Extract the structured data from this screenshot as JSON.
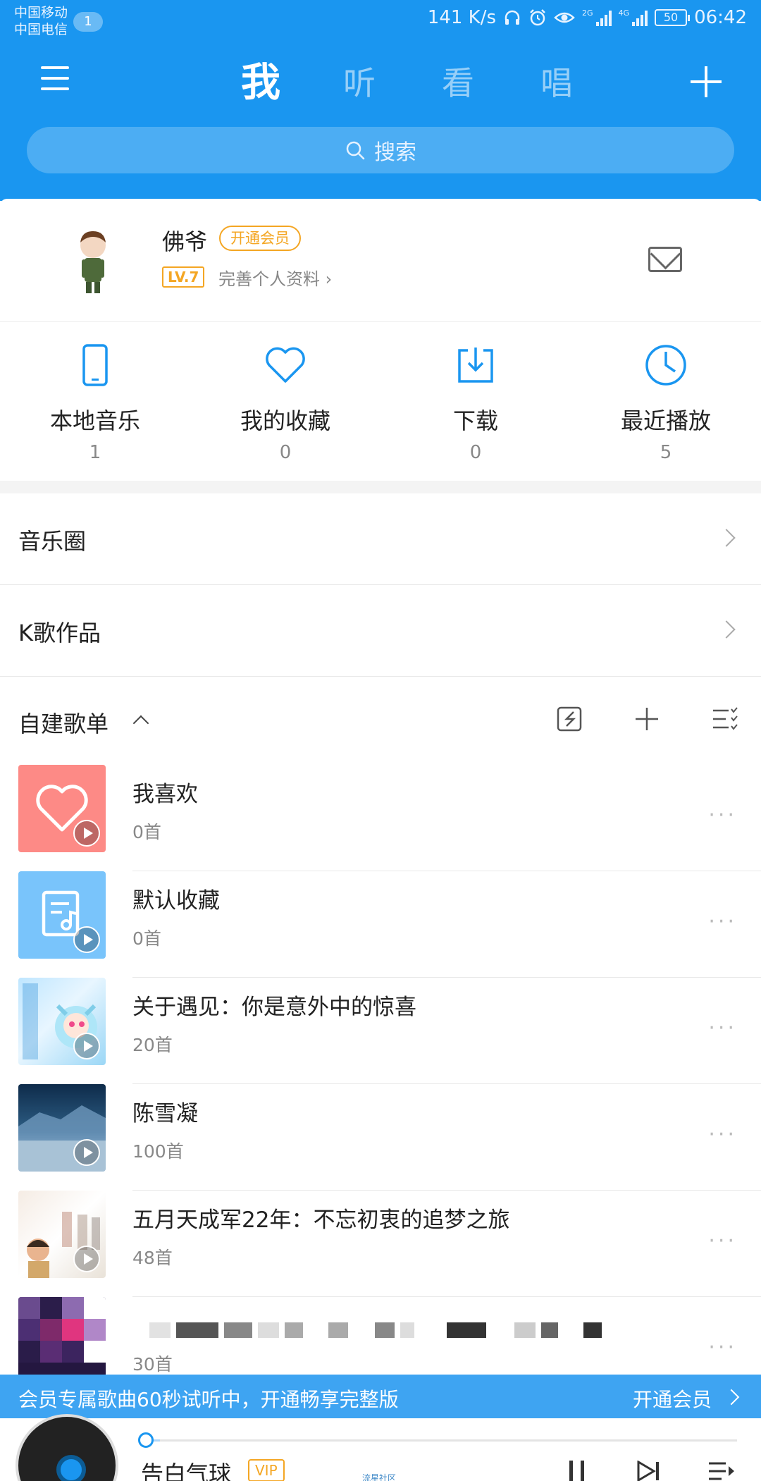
{
  "status_bar": {
    "carrier1": "中国移动",
    "carrier2": "中国电信",
    "notification_count": "1",
    "speed": "141 K/s",
    "net1": "2G",
    "net2": "4G",
    "battery": "50",
    "time": "06:42"
  },
  "nav": {
    "tabs": [
      {
        "label": "我",
        "active": true
      },
      {
        "label": "听",
        "active": false
      },
      {
        "label": "看",
        "active": false
      },
      {
        "label": "唱",
        "active": false
      }
    ],
    "search_placeholder": "搜索"
  },
  "profile": {
    "name": "佛爷",
    "vip_button": "开通会员",
    "level": "LV.7",
    "complete_profile": "完善个人资料"
  },
  "quick_access": [
    {
      "label": "本地音乐",
      "count": "1",
      "icon": "phone-icon"
    },
    {
      "label": "我的收藏",
      "count": "0",
      "icon": "heart-icon"
    },
    {
      "label": "下载",
      "count": "0",
      "icon": "download-icon"
    },
    {
      "label": "最近播放",
      "count": "5",
      "icon": "clock-icon"
    }
  ],
  "menu_rows": [
    {
      "label": "音乐圈"
    },
    {
      "label": "K歌作品"
    }
  ],
  "playlists_section": {
    "title": "自建歌单",
    "items": [
      {
        "name": "我喜欢",
        "count": "0首"
      },
      {
        "name": "默认收藏",
        "count": "0首"
      },
      {
        "name": "关于遇见：你是意外中的惊喜",
        "count": "20首"
      },
      {
        "name": "陈雪凝",
        "count": "100首"
      },
      {
        "name": "五月天成军22年：不忘初衷的追梦之旅",
        "count": "48首"
      },
      {
        "name": "",
        "count": "30首"
      }
    ]
  },
  "promo": {
    "text": "会员专属歌曲60秒试听中，开通畅享完整版",
    "button": "开通会员"
  },
  "player": {
    "song": "告白气球",
    "vip_tag": "VIP",
    "small_tag": "流星社区",
    "progress": 0.02
  },
  "colors": {
    "primary_blue": "#1a96f0",
    "vip_orange": "#f4a623"
  }
}
